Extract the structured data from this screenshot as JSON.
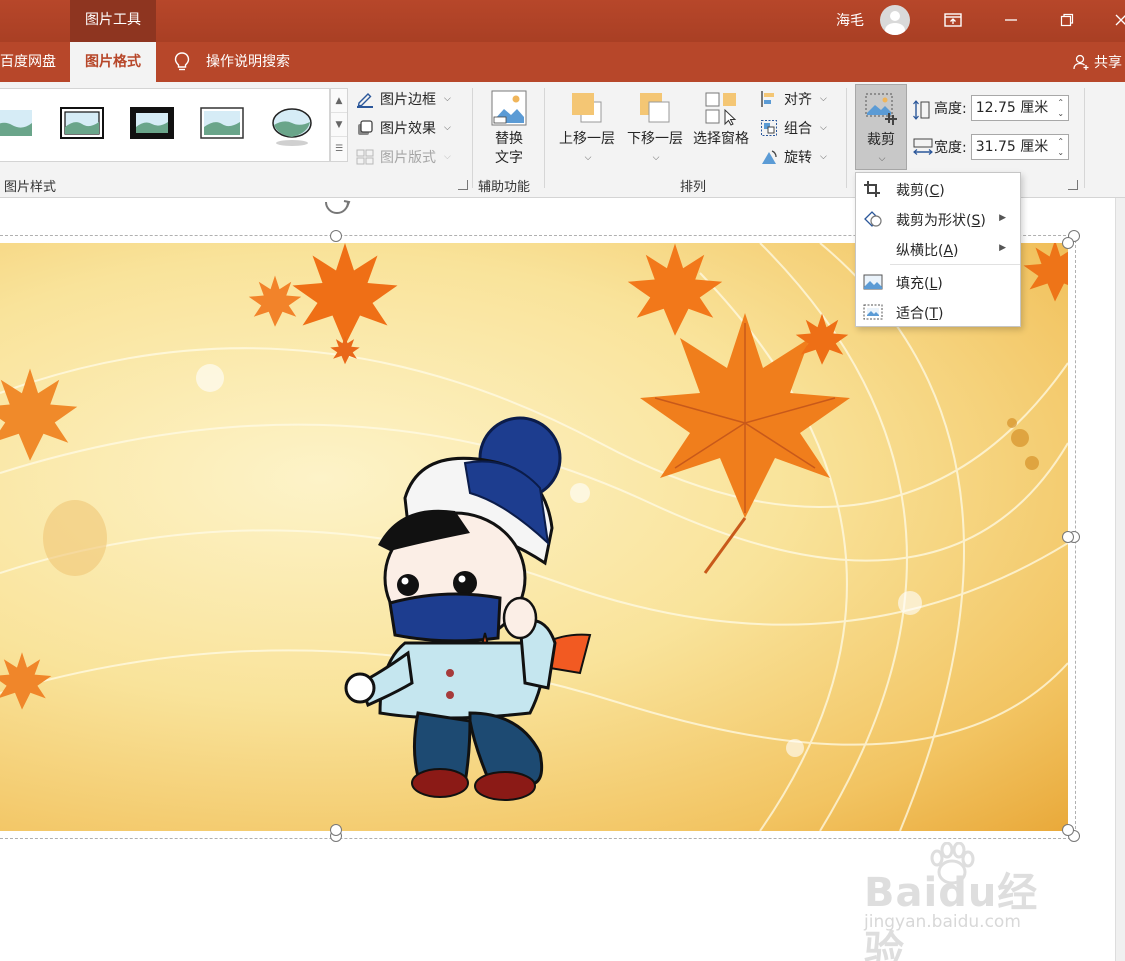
{
  "window": {
    "tools_tab": "图片工具",
    "user_name": "海毛"
  },
  "tabs": {
    "baidu": "百度网盘",
    "picture_format": "图片格式",
    "search": "操作说明搜索",
    "share": "共享"
  },
  "ribbon": {
    "styles_group": "图片样式",
    "border": "图片边框",
    "effects": "图片效果",
    "layout": "图片版式",
    "alt_text_line1": "替换",
    "alt_text_line2": "文字",
    "accessibility_group": "辅助功能",
    "bring_forward": "上移一层",
    "send_backward": "下移一层",
    "selection_pane": "选择窗格",
    "align": "对齐",
    "group": "组合",
    "rotate": "旋转",
    "arrange_group": "排列",
    "crop": "裁剪",
    "height_label": "高度:",
    "height_value": "12.75 厘米",
    "width_label": "宽度:",
    "width_value": "31.75 厘米"
  },
  "crop_menu": {
    "crop_text": "裁剪(",
    "crop_key": "C",
    "crop_shape_text": "裁剪为形状(",
    "crop_shape_key": "S",
    "aspect_text": "纵横比(",
    "aspect_key": "A",
    "fill_text": "填充(",
    "fill_key": "L",
    "fit_text": "适合(",
    "fit_key": "T",
    "close_paren": ")"
  },
  "watermark": {
    "brand": "Baidu经验",
    "url": "jingyan.baidu.com"
  },
  "colors": {
    "accent": "#b7472a",
    "accent_dark": "#8e3520",
    "ribbon_bg": "#f3f3f3"
  }
}
